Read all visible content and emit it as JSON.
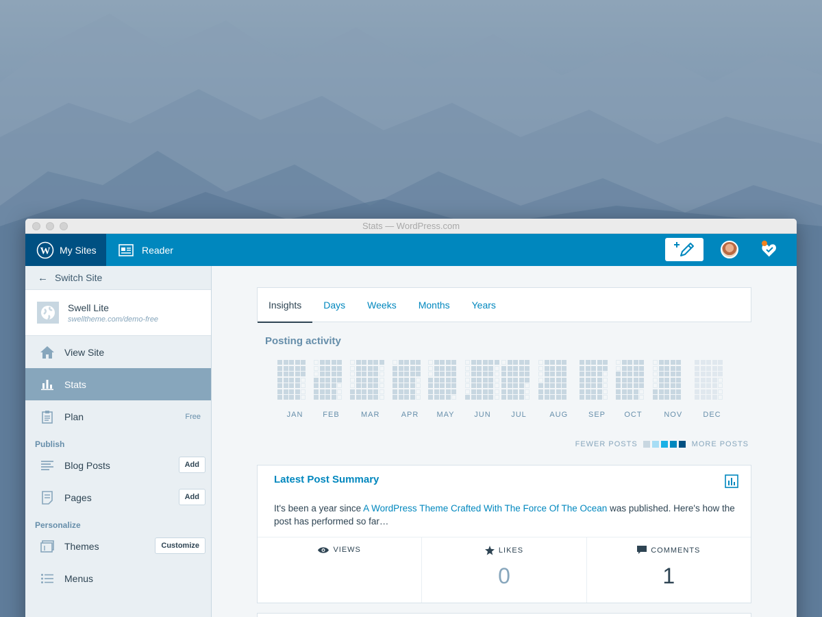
{
  "window": {
    "title": "Stats — WordPress.com"
  },
  "masterbar": {
    "my_sites": "My Sites",
    "reader": "Reader",
    "accent": "#0087be",
    "dark": "#005082"
  },
  "sidebar": {
    "switch_site": "Switch Site",
    "site_name": "Swell Lite",
    "site_url": "swelltheme.com/demo-free",
    "items": [
      {
        "label": "View Site",
        "icon": "home-icon"
      },
      {
        "label": "Stats",
        "icon": "stats-icon",
        "selected": true
      },
      {
        "label": "Plan",
        "icon": "clipboard-icon",
        "badge": "Free"
      }
    ],
    "publish_label": "Publish",
    "publish_items": [
      {
        "label": "Blog Posts",
        "icon": "posts-icon",
        "action": "Add"
      },
      {
        "label": "Pages",
        "icon": "page-icon",
        "action": "Add"
      }
    ],
    "personalize_label": "Personalize",
    "personalize_items": [
      {
        "label": "Themes",
        "icon": "themes-icon",
        "action": "Customize"
      },
      {
        "label": "Menus",
        "icon": "menus-icon"
      }
    ]
  },
  "tabs": [
    "Insights",
    "Days",
    "Weeks",
    "Months",
    "Years"
  ],
  "posting_activity": {
    "title": "Posting activity",
    "months": [
      "JAN",
      "FEB",
      "MAR",
      "APR",
      "MAY",
      "JUN",
      "JUL",
      "AUG",
      "SEP",
      "OCT",
      "NOV",
      "DEC"
    ],
    "legend_fewer": "FEWER POSTS",
    "legend_more": "MORE POSTS",
    "legend_colors": [
      "#c8d7e1",
      "#a6ddf5",
      "#1ab1e6",
      "#0087be",
      "#005082"
    ]
  },
  "latest_post": {
    "title": "Latest Post Summary",
    "text_before": "It's been a year since ",
    "link": "A WordPress Theme Crafted With The Force Of The Ocean",
    "text_after": " was published. Here's how the post has performed so far…",
    "stats": [
      {
        "label": "VIEWS",
        "icon": "eye-icon",
        "value": ""
      },
      {
        "label": "LIKES",
        "icon": "star-icon",
        "value": "0"
      },
      {
        "label": "COMMENTS",
        "icon": "comment-icon",
        "value": "1"
      }
    ]
  }
}
